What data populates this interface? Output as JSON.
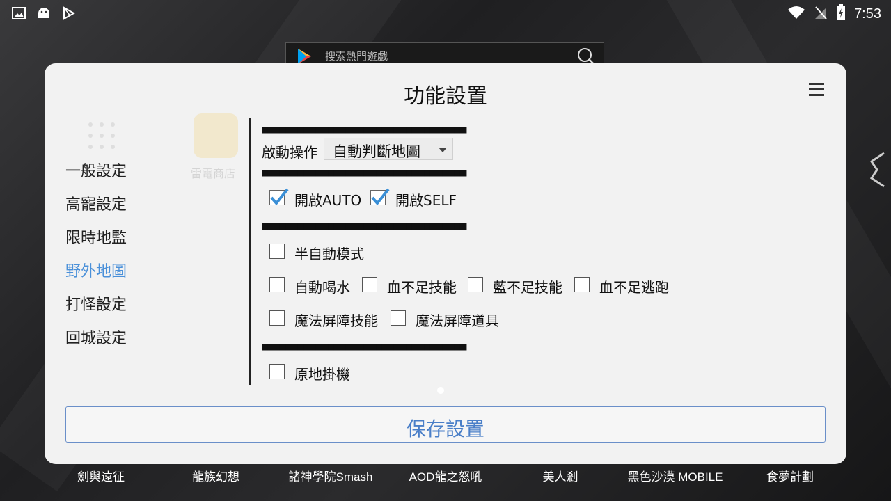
{
  "status_bar": {
    "time": "7:53",
    "left_icons": [
      "image-icon",
      "android-icon",
      "play-store-icon"
    ],
    "right_icons": [
      "wifi-icon",
      "signal-off-icon",
      "battery-charging-icon"
    ]
  },
  "search": {
    "placeholder": "搜索熱門遊戲"
  },
  "background": {
    "store_label": "雷電商店"
  },
  "dialog": {
    "title": "功能設置",
    "sidebar": [
      {
        "label": "一般設定",
        "active": false
      },
      {
        "label": "高寵設定",
        "active": false
      },
      {
        "label": "限時地監",
        "active": false
      },
      {
        "label": "野外地圖",
        "active": true
      },
      {
        "label": "打怪設定",
        "active": false
      },
      {
        "label": "回城設定",
        "active": false
      }
    ],
    "separator": "■■■■■■■■■■■■■■■■■■■■■■■■■■■■■■■■■■",
    "start_label": "啟動操作",
    "start_select": "自動判斷地圖",
    "checks": [
      {
        "label": "開啟AUTO",
        "checked": true
      },
      {
        "label": "開啟SELF",
        "checked": true
      },
      {
        "label": "半自動模式",
        "checked": false
      },
      {
        "label": "自動喝水",
        "checked": false
      },
      {
        "label": "血不足技能",
        "checked": false
      },
      {
        "label": "藍不足技能",
        "checked": false
      },
      {
        "label": "血不足逃跑",
        "checked": false
      },
      {
        "label": "魔法屏障技能",
        "checked": false
      },
      {
        "label": "魔法屏障道具",
        "checked": false
      },
      {
        "label": "原地掛機",
        "checked": false
      }
    ],
    "save_label": "保存設置"
  },
  "dock": [
    {
      "label": "劍與遠征"
    },
    {
      "label": "龍族幻想"
    },
    {
      "label": "諸神學院Smash"
    },
    {
      "label": "AOD龍之怒吼"
    },
    {
      "label": "美人剎"
    },
    {
      "label": "黑色沙漠 MOBILE"
    },
    {
      "label": "食夢計劃"
    }
  ],
  "colors": {
    "accent": "#4a90d9",
    "check_blue": "#3a8fd6",
    "dialog_bg": "#f2f2f2"
  }
}
